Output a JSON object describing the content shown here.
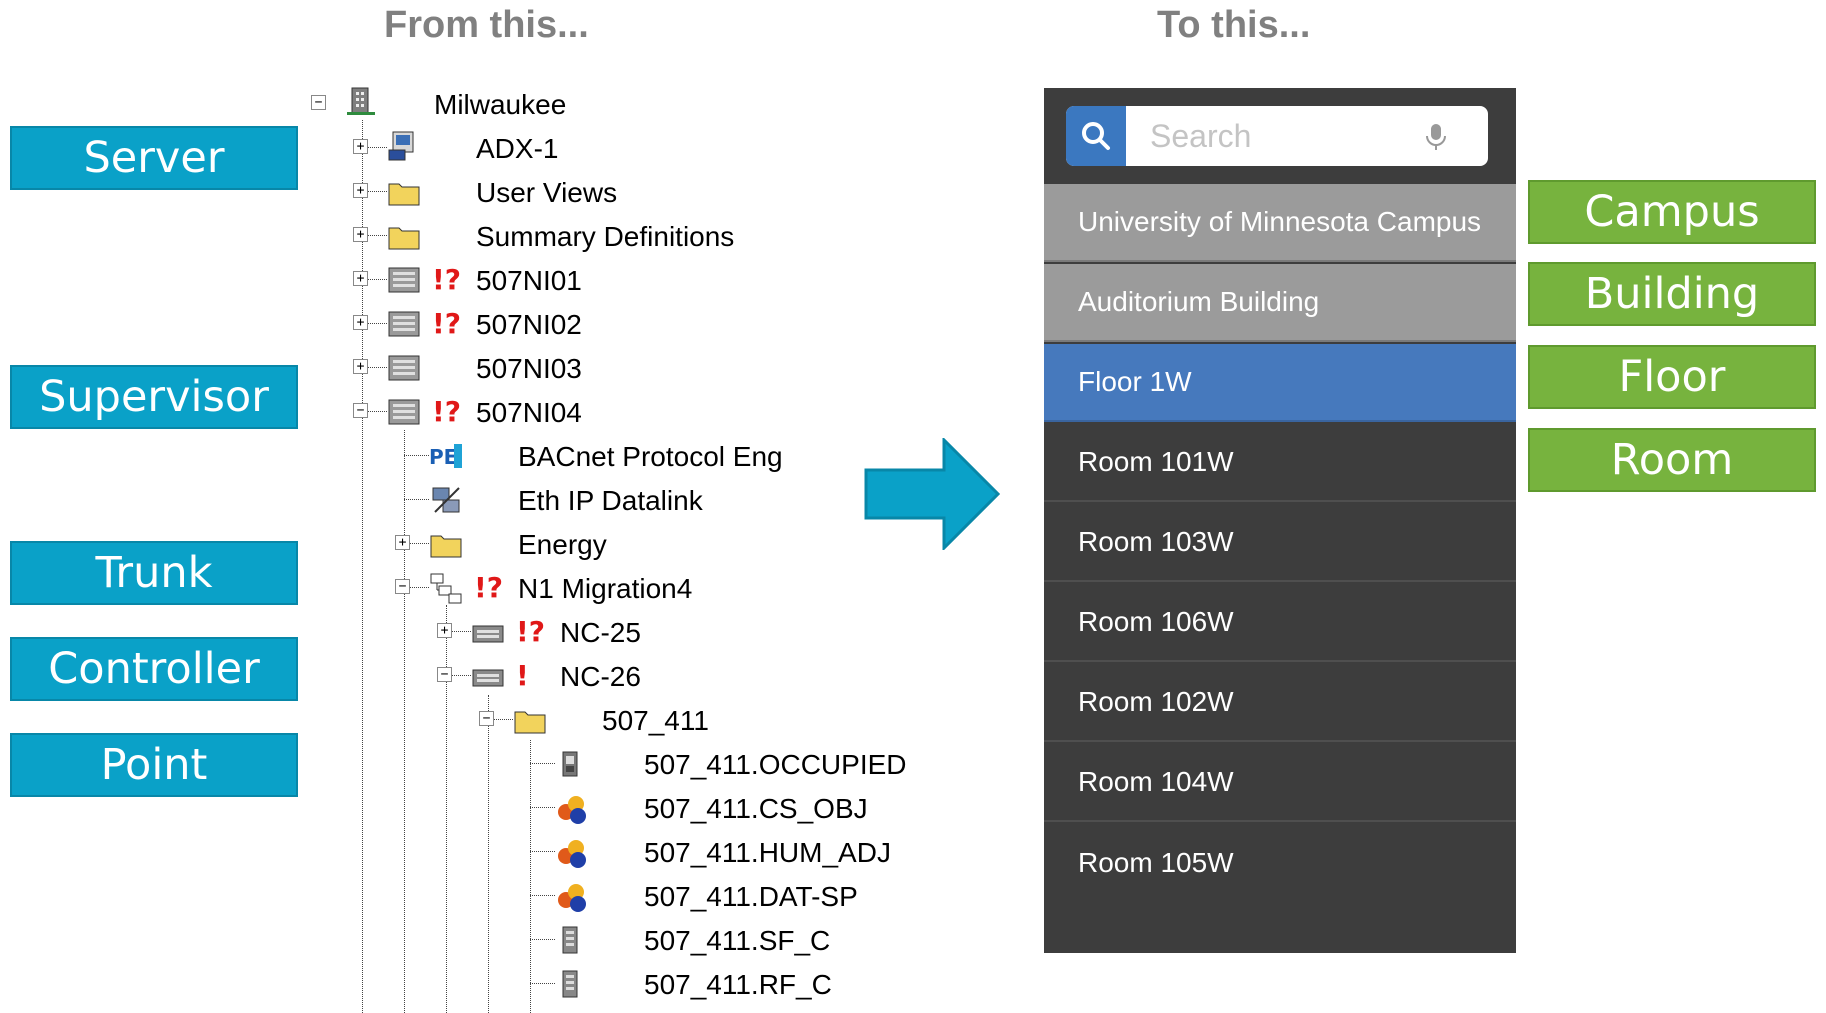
{
  "headers": {
    "left": "From this...",
    "right": "To this..."
  },
  "left_tags": [
    "Server",
    "Supervisor",
    "Trunk",
    "Controller",
    "Point"
  ],
  "right_tags": [
    "Campus",
    "Building",
    "Floor",
    "Room"
  ],
  "tree": {
    "nodes": [
      {
        "label": "Milwaukee",
        "icon": "building-icon"
      },
      {
        "label": "ADX-1",
        "icon": "server-icon"
      },
      {
        "label": "User Views",
        "icon": "folder-icon"
      },
      {
        "label": "Summary Definitions",
        "icon": "folder-icon"
      },
      {
        "label": "507NI01",
        "icon": "device-icon",
        "warn": "!?"
      },
      {
        "label": "507NI02",
        "icon": "device-icon",
        "warn": "!?"
      },
      {
        "label": "507NI03",
        "icon": "device-icon"
      },
      {
        "label": "507NI04",
        "icon": "device-icon",
        "warn": "!?"
      },
      {
        "label": "BACnet Protocol Eng",
        "icon": "protocol-engine-icon"
      },
      {
        "label": "Eth IP Datalink",
        "icon": "datalink-icon"
      },
      {
        "label": "Energy",
        "icon": "folder-icon"
      },
      {
        "label": "N1 Migration4",
        "icon": "network-icon",
        "warn": "!?"
      },
      {
        "label": "NC-25",
        "icon": "controller-icon",
        "warn": "!?"
      },
      {
        "label": "NC-26",
        "icon": "controller-icon",
        "warn": "!"
      },
      {
        "label": "507_411",
        "icon": "folder-icon"
      },
      {
        "label": "507_411.OCCUPIED",
        "icon": "binary-point-icon"
      },
      {
        "label": "507_411.CS_OBJ",
        "icon": "object-icon"
      },
      {
        "label": "507_411.HUM_ADJ",
        "icon": "object-icon"
      },
      {
        "label": "507_411.DAT-SP",
        "icon": "object-icon"
      },
      {
        "label": "507_411.SF_C",
        "icon": "analog-point-icon"
      },
      {
        "label": "507_411.RF_C",
        "icon": "analog-point-icon"
      }
    ]
  },
  "mobile": {
    "search_placeholder": "Search",
    "rows": [
      {
        "label": "University of Minnesota Campus",
        "state": "ancestor"
      },
      {
        "label": "Auditorium Building",
        "state": "ancestor"
      },
      {
        "label": "Floor 1W",
        "state": "selected"
      },
      {
        "label": "Room 101W",
        "state": "normal"
      },
      {
        "label": "Room 103W",
        "state": "normal"
      },
      {
        "label": "Room 106W",
        "state": "normal"
      },
      {
        "label": "Room 102W",
        "state": "normal"
      },
      {
        "label": "Room 104W",
        "state": "normal"
      },
      {
        "label": "Room 105W",
        "state": "normal"
      }
    ]
  },
  "colors": {
    "tag_blue": "#0aa1c8",
    "tag_green": "#77b33e",
    "arrow": "#0aa1c8",
    "selected_row": "#4679bd",
    "ancestor_row": "#9b9b9b",
    "panel": "#3d3d3d"
  }
}
